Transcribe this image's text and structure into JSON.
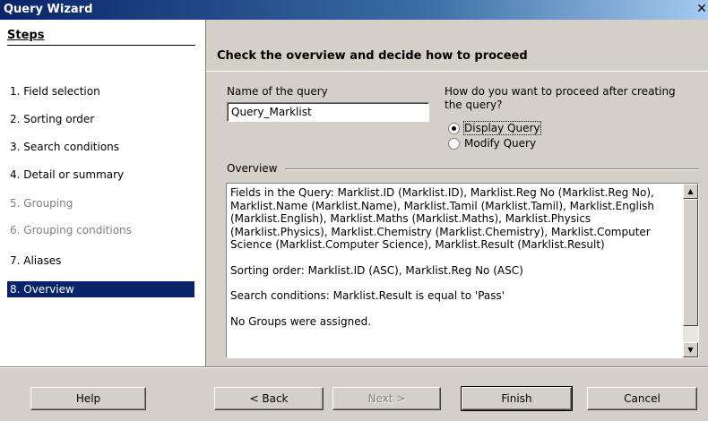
{
  "window": {
    "title": "Query Wizard",
    "close_glyph": "✕"
  },
  "steps": {
    "heading": "Steps",
    "items": [
      {
        "label": "1.  Field selection",
        "state": "normal"
      },
      {
        "label": "2.  Sorting order",
        "state": "normal"
      },
      {
        "label": "3.  Search conditions",
        "state": "normal"
      },
      {
        "label": "4.  Detail or summary",
        "state": "normal"
      },
      {
        "label": "5.  Grouping",
        "state": "disabled"
      },
      {
        "label": "6.  Grouping conditions",
        "state": "disabled"
      },
      {
        "label": "7.  Aliases",
        "state": "normal"
      },
      {
        "label": "8.  Overview",
        "state": "selected"
      }
    ]
  },
  "main": {
    "heading": "Check the overview and decide how to proceed",
    "name_label": "Name of the query",
    "name_value": "Query_Marklist",
    "proceed_label_line1": "How do you want to proceed after creating",
    "proceed_label_line2": "the query?",
    "radio_display": "Display Query",
    "radio_modify": "Modify Query",
    "selected_radio": "Display Query",
    "overview_label": "Overview",
    "overview_paragraphs": [
      "Fields in the Query: Marklist.ID (Marklist.ID), Marklist.Reg No (Marklist.Reg No), Marklist.Name (Marklist.Name), Marklist.Tamil (Marklist.Tamil), Marklist.English (Marklist.English), Marklist.Maths (Marklist.Maths), Marklist.Physics (Marklist.Physics), Marklist.Chemistry (Marklist.Chemistry), Marklist.Computer Science (Marklist.Computer Science), Marklist.Result (Marklist.Result)",
      "Sorting order: Marklist.ID (ASC), Marklist.Reg No (ASC)",
      "Search conditions: Marklist.Result is equal to 'Pass'",
      "No Groups were assigned."
    ]
  },
  "buttons": {
    "help": "Help",
    "back": "< Back",
    "next": "Next >",
    "finish": "Finish",
    "cancel": "Cancel"
  },
  "icons": {
    "scroll_up": "up-arrow-icon",
    "scroll_down": "down-arrow-icon"
  }
}
